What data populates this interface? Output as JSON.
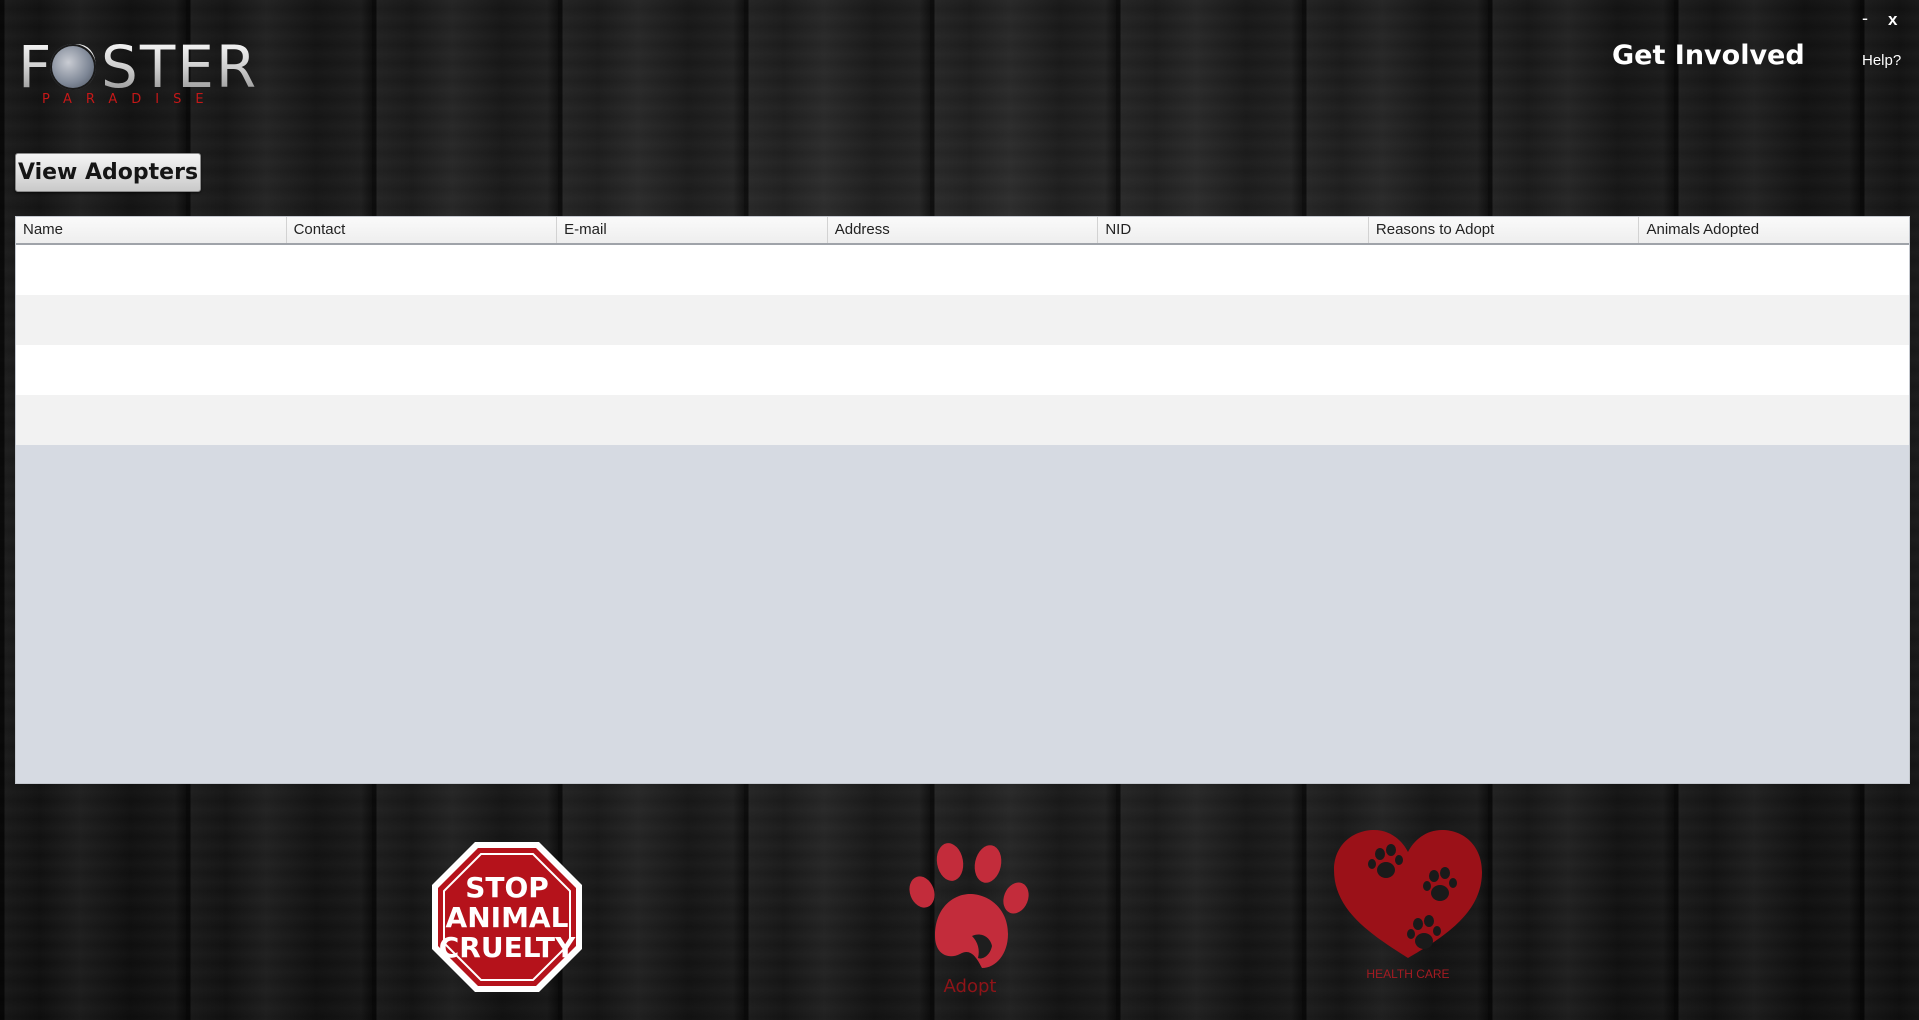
{
  "app": {
    "logo_text": "FOSTER",
    "logo_subtext": "PARADISE"
  },
  "window_controls": {
    "minimize": "-",
    "close": "x"
  },
  "header": {
    "get_involved": "Get Involved",
    "help": "Help?"
  },
  "toolbar": {
    "view_adopters": "View Adopters"
  },
  "table": {
    "columns": [
      "Name",
      "Contact",
      "E-mail",
      "Address",
      "NID",
      "Reasons to Adopt",
      "Animals Adopted"
    ],
    "rows": []
  },
  "bottom_icons": {
    "stop_sign": [
      "STOP",
      "ANIMAL",
      "CRUELTY"
    ],
    "adopt": "Adopt",
    "health_care": "HEALTH CARE"
  },
  "colors": {
    "accent_red": "#c41818",
    "table_empty_area": "#d6dae2"
  }
}
